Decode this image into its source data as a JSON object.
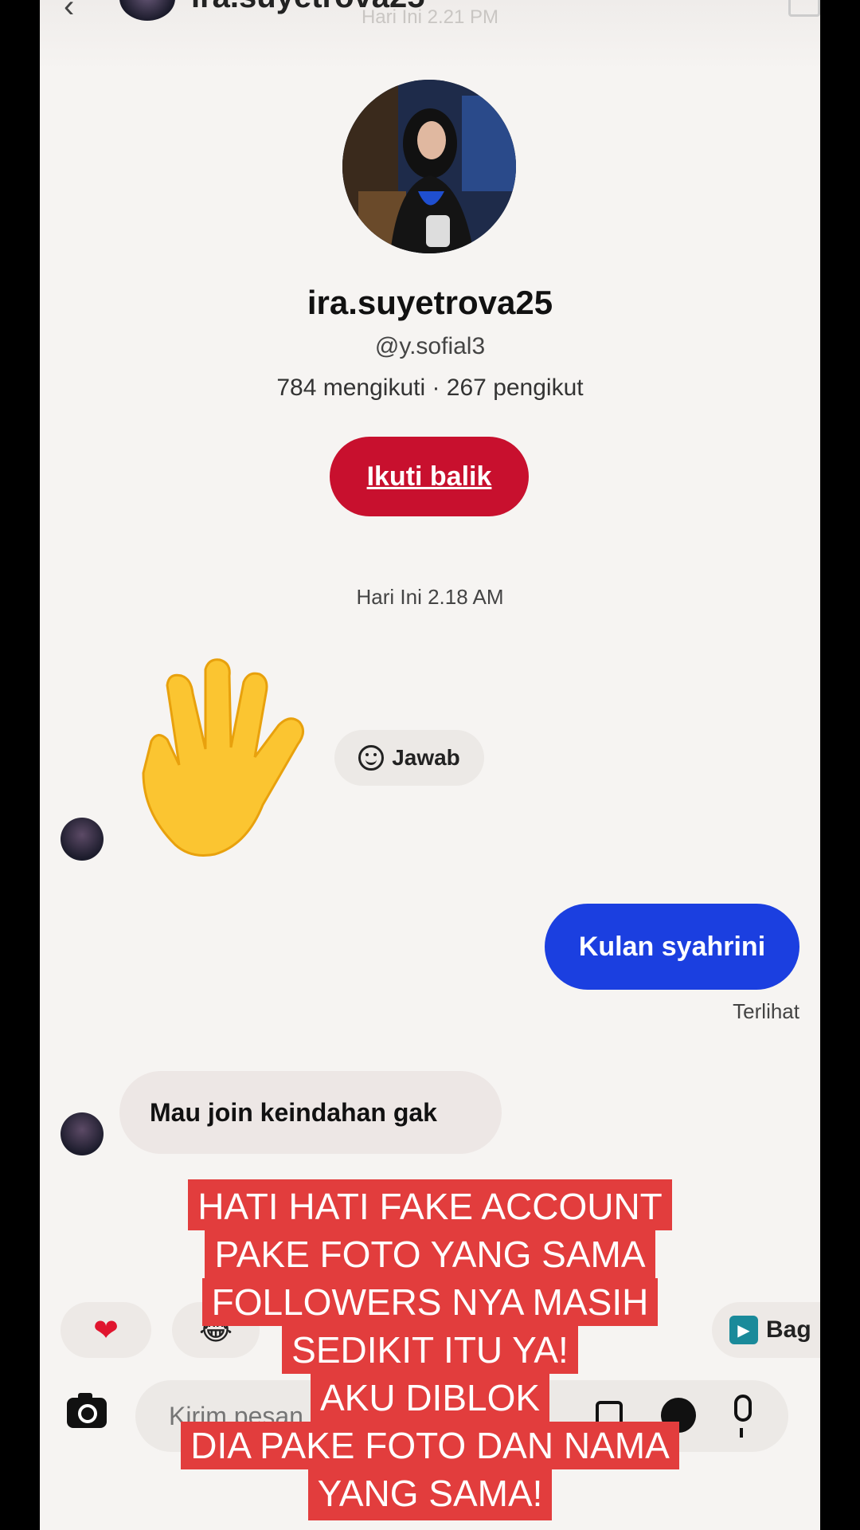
{
  "header": {
    "name": "ira.suyetrova25",
    "time": "Hari Ini 2.21 PM"
  },
  "profile": {
    "name": "ira.suyetrova25",
    "handle": "@y.sofial3",
    "stats": "784 mengikuti · 267 pengikut",
    "follow_label": "Ikuti balik"
  },
  "conversation": {
    "timestamp": "Hari Ini 2.18 AM",
    "wave_reply_label": "Jawab",
    "sent_message": "Kulan syahrini",
    "seen_label": "Terlihat",
    "received_message": "Mau join keindahan gak"
  },
  "quick_replies": {
    "partial_label": "Bag"
  },
  "composer": {
    "placeholder": "Kirim pesan..."
  },
  "caption": {
    "lines": [
      "HATI HATI FAKE ACCOUNT",
      "PAKE FOTO YANG SAMA",
      "FOLLOWERS NYA MASIH",
      "SEDIKIT ITU YA!",
      "AKU DIBLOK",
      "DIA PAKE FOTO DAN NAMA",
      "YANG SAMA!"
    ]
  },
  "colors": {
    "follow_button": "#c8102e",
    "sent_bubble": "#1b3fe0",
    "caption_bg": "#e23d3d"
  }
}
